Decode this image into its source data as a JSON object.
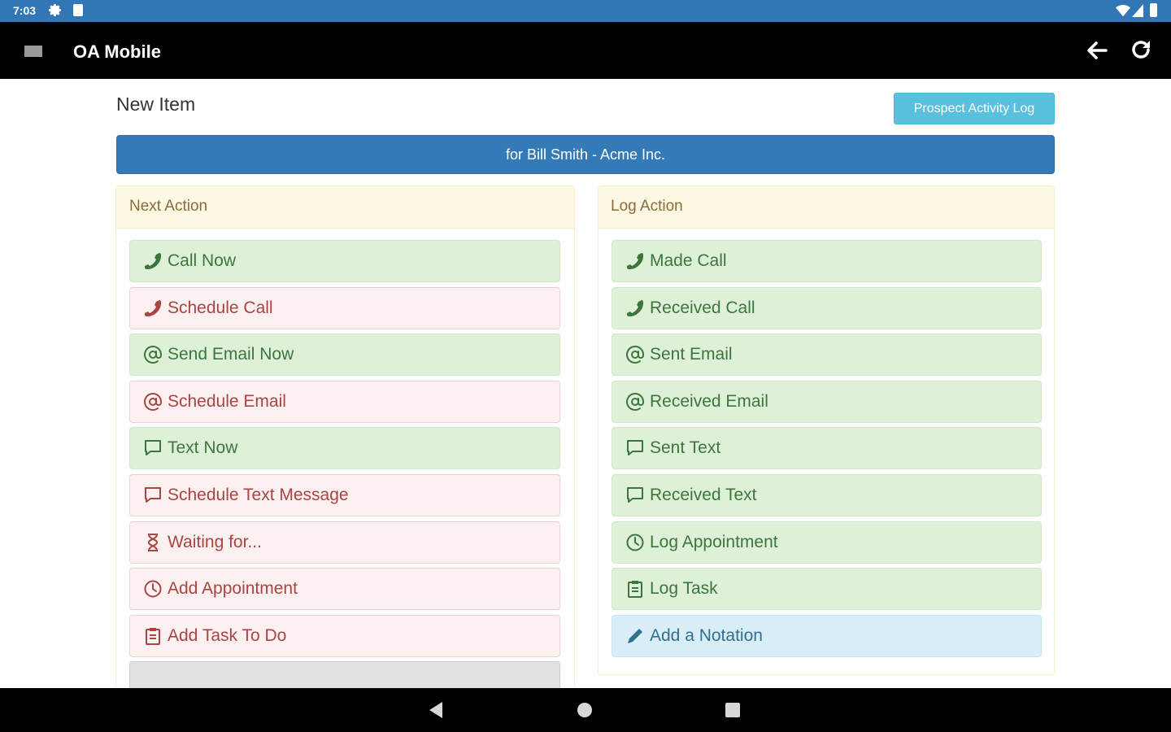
{
  "status_bar": {
    "time": "7:03"
  },
  "app_bar": {
    "title": "OA Mobile"
  },
  "page": {
    "title": "New Item",
    "activity_log_button": "Prospect Activity Log",
    "for_banner": "for Bill Smith - Acme Inc."
  },
  "next_action": {
    "heading": "Next Action",
    "items": [
      {
        "label": "Call Now",
        "icon": "phone-icon",
        "style": "success"
      },
      {
        "label": "Schedule Call",
        "icon": "phone-icon",
        "style": "danger"
      },
      {
        "label": "Send Email Now",
        "icon": "at-icon",
        "style": "success"
      },
      {
        "label": "Schedule Email",
        "icon": "at-icon",
        "style": "danger"
      },
      {
        "label": "Text Now",
        "icon": "chat-bubble-icon",
        "style": "success"
      },
      {
        "label": "Schedule Text Message",
        "icon": "chat-bubble-icon",
        "style": "danger"
      },
      {
        "label": "Waiting for...",
        "icon": "hourglass-icon",
        "style": "danger"
      },
      {
        "label": "Add Appointment",
        "icon": "clock-icon",
        "style": "danger"
      },
      {
        "label": "Add Task To Do",
        "icon": "clipboard-icon",
        "style": "danger"
      }
    ]
  },
  "log_action": {
    "heading": "Log Action",
    "items": [
      {
        "label": "Made Call",
        "icon": "phone-icon",
        "style": "success"
      },
      {
        "label": "Received Call",
        "icon": "phone-icon",
        "style": "success"
      },
      {
        "label": "Sent Email",
        "icon": "at-icon",
        "style": "success"
      },
      {
        "label": "Received Email",
        "icon": "at-icon",
        "style": "success"
      },
      {
        "label": "Sent Text",
        "icon": "chat-bubble-icon",
        "style": "success"
      },
      {
        "label": "Received Text",
        "icon": "chat-bubble-icon",
        "style": "success"
      },
      {
        "label": "Log Appointment",
        "icon": "clock-icon",
        "style": "success"
      },
      {
        "label": "Log Task",
        "icon": "clipboard-icon",
        "style": "success"
      },
      {
        "label": "Add a Notation",
        "icon": "pencil-icon",
        "style": "info"
      }
    ]
  },
  "colors": {
    "status_bar": "#3176b5",
    "app_bar": "#000000",
    "primary": "#337ab7",
    "info": "#5bc0de",
    "success_bg": "#dff0d8",
    "success_text": "#3c763d",
    "danger_bg": "#fdf0f0",
    "danger_text": "#a94442",
    "warning_bg": "#fcf8e3",
    "warning_text": "#8a6d3b"
  }
}
